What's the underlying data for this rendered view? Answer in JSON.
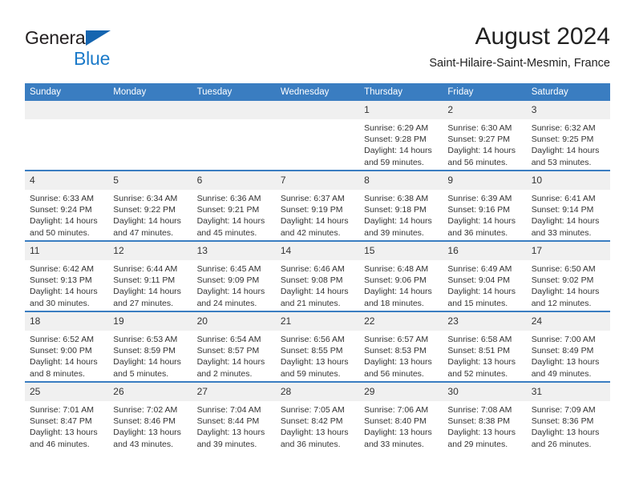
{
  "brand": {
    "line1": "General",
    "line2": "Blue",
    "triangle_color": "#1565b0",
    "blue_text_color": "#1b7ac9"
  },
  "header": {
    "title": "August 2024",
    "subtitle": "Saint-Hilaire-Saint-Mesmin, France"
  },
  "theme": {
    "header_row_bg": "#3a7dc1",
    "daynum_bg": "#f0f0f0",
    "row_divider": "#3a7dc1"
  },
  "calendar": {
    "weekday_headers": [
      "Sunday",
      "Monday",
      "Tuesday",
      "Wednesday",
      "Thursday",
      "Friday",
      "Saturday"
    ],
    "labels": {
      "sunrise": "Sunrise:",
      "sunset": "Sunset:",
      "daylight": "Daylight:"
    },
    "weeks": [
      [
        {
          "day": "",
          "empty": true
        },
        {
          "day": "",
          "empty": true
        },
        {
          "day": "",
          "empty": true
        },
        {
          "day": "",
          "empty": true
        },
        {
          "day": "1",
          "sunrise": "Sunrise: 6:29 AM",
          "sunset": "Sunset: 9:28 PM",
          "daylight": "Daylight: 14 hours and 59 minutes."
        },
        {
          "day": "2",
          "sunrise": "Sunrise: 6:30 AM",
          "sunset": "Sunset: 9:27 PM",
          "daylight": "Daylight: 14 hours and 56 minutes."
        },
        {
          "day": "3",
          "sunrise": "Sunrise: 6:32 AM",
          "sunset": "Sunset: 9:25 PM",
          "daylight": "Daylight: 14 hours and 53 minutes."
        }
      ],
      [
        {
          "day": "4",
          "sunrise": "Sunrise: 6:33 AM",
          "sunset": "Sunset: 9:24 PM",
          "daylight": "Daylight: 14 hours and 50 minutes."
        },
        {
          "day": "5",
          "sunrise": "Sunrise: 6:34 AM",
          "sunset": "Sunset: 9:22 PM",
          "daylight": "Daylight: 14 hours and 47 minutes."
        },
        {
          "day": "6",
          "sunrise": "Sunrise: 6:36 AM",
          "sunset": "Sunset: 9:21 PM",
          "daylight": "Daylight: 14 hours and 45 minutes."
        },
        {
          "day": "7",
          "sunrise": "Sunrise: 6:37 AM",
          "sunset": "Sunset: 9:19 PM",
          "daylight": "Daylight: 14 hours and 42 minutes."
        },
        {
          "day": "8",
          "sunrise": "Sunrise: 6:38 AM",
          "sunset": "Sunset: 9:18 PM",
          "daylight": "Daylight: 14 hours and 39 minutes."
        },
        {
          "day": "9",
          "sunrise": "Sunrise: 6:39 AM",
          "sunset": "Sunset: 9:16 PM",
          "daylight": "Daylight: 14 hours and 36 minutes."
        },
        {
          "day": "10",
          "sunrise": "Sunrise: 6:41 AM",
          "sunset": "Sunset: 9:14 PM",
          "daylight": "Daylight: 14 hours and 33 minutes."
        }
      ],
      [
        {
          "day": "11",
          "sunrise": "Sunrise: 6:42 AM",
          "sunset": "Sunset: 9:13 PM",
          "daylight": "Daylight: 14 hours and 30 minutes."
        },
        {
          "day": "12",
          "sunrise": "Sunrise: 6:44 AM",
          "sunset": "Sunset: 9:11 PM",
          "daylight": "Daylight: 14 hours and 27 minutes."
        },
        {
          "day": "13",
          "sunrise": "Sunrise: 6:45 AM",
          "sunset": "Sunset: 9:09 PM",
          "daylight": "Daylight: 14 hours and 24 minutes."
        },
        {
          "day": "14",
          "sunrise": "Sunrise: 6:46 AM",
          "sunset": "Sunset: 9:08 PM",
          "daylight": "Daylight: 14 hours and 21 minutes."
        },
        {
          "day": "15",
          "sunrise": "Sunrise: 6:48 AM",
          "sunset": "Sunset: 9:06 PM",
          "daylight": "Daylight: 14 hours and 18 minutes."
        },
        {
          "day": "16",
          "sunrise": "Sunrise: 6:49 AM",
          "sunset": "Sunset: 9:04 PM",
          "daylight": "Daylight: 14 hours and 15 minutes."
        },
        {
          "day": "17",
          "sunrise": "Sunrise: 6:50 AM",
          "sunset": "Sunset: 9:02 PM",
          "daylight": "Daylight: 14 hours and 12 minutes."
        }
      ],
      [
        {
          "day": "18",
          "sunrise": "Sunrise: 6:52 AM",
          "sunset": "Sunset: 9:00 PM",
          "daylight": "Daylight: 14 hours and 8 minutes."
        },
        {
          "day": "19",
          "sunrise": "Sunrise: 6:53 AM",
          "sunset": "Sunset: 8:59 PM",
          "daylight": "Daylight: 14 hours and 5 minutes."
        },
        {
          "day": "20",
          "sunrise": "Sunrise: 6:54 AM",
          "sunset": "Sunset: 8:57 PM",
          "daylight": "Daylight: 14 hours and 2 minutes."
        },
        {
          "day": "21",
          "sunrise": "Sunrise: 6:56 AM",
          "sunset": "Sunset: 8:55 PM",
          "daylight": "Daylight: 13 hours and 59 minutes."
        },
        {
          "day": "22",
          "sunrise": "Sunrise: 6:57 AM",
          "sunset": "Sunset: 8:53 PM",
          "daylight": "Daylight: 13 hours and 56 minutes."
        },
        {
          "day": "23",
          "sunrise": "Sunrise: 6:58 AM",
          "sunset": "Sunset: 8:51 PM",
          "daylight": "Daylight: 13 hours and 52 minutes."
        },
        {
          "day": "24",
          "sunrise": "Sunrise: 7:00 AM",
          "sunset": "Sunset: 8:49 PM",
          "daylight": "Daylight: 13 hours and 49 minutes."
        }
      ],
      [
        {
          "day": "25",
          "sunrise": "Sunrise: 7:01 AM",
          "sunset": "Sunset: 8:47 PM",
          "daylight": "Daylight: 13 hours and 46 minutes."
        },
        {
          "day": "26",
          "sunrise": "Sunrise: 7:02 AM",
          "sunset": "Sunset: 8:46 PM",
          "daylight": "Daylight: 13 hours and 43 minutes."
        },
        {
          "day": "27",
          "sunrise": "Sunrise: 7:04 AM",
          "sunset": "Sunset: 8:44 PM",
          "daylight": "Daylight: 13 hours and 39 minutes."
        },
        {
          "day": "28",
          "sunrise": "Sunrise: 7:05 AM",
          "sunset": "Sunset: 8:42 PM",
          "daylight": "Daylight: 13 hours and 36 minutes."
        },
        {
          "day": "29",
          "sunrise": "Sunrise: 7:06 AM",
          "sunset": "Sunset: 8:40 PM",
          "daylight": "Daylight: 13 hours and 33 minutes."
        },
        {
          "day": "30",
          "sunrise": "Sunrise: 7:08 AM",
          "sunset": "Sunset: 8:38 PM",
          "daylight": "Daylight: 13 hours and 29 minutes."
        },
        {
          "day": "31",
          "sunrise": "Sunrise: 7:09 AM",
          "sunset": "Sunset: 8:36 PM",
          "daylight": "Daylight: 13 hours and 26 minutes."
        }
      ]
    ]
  }
}
